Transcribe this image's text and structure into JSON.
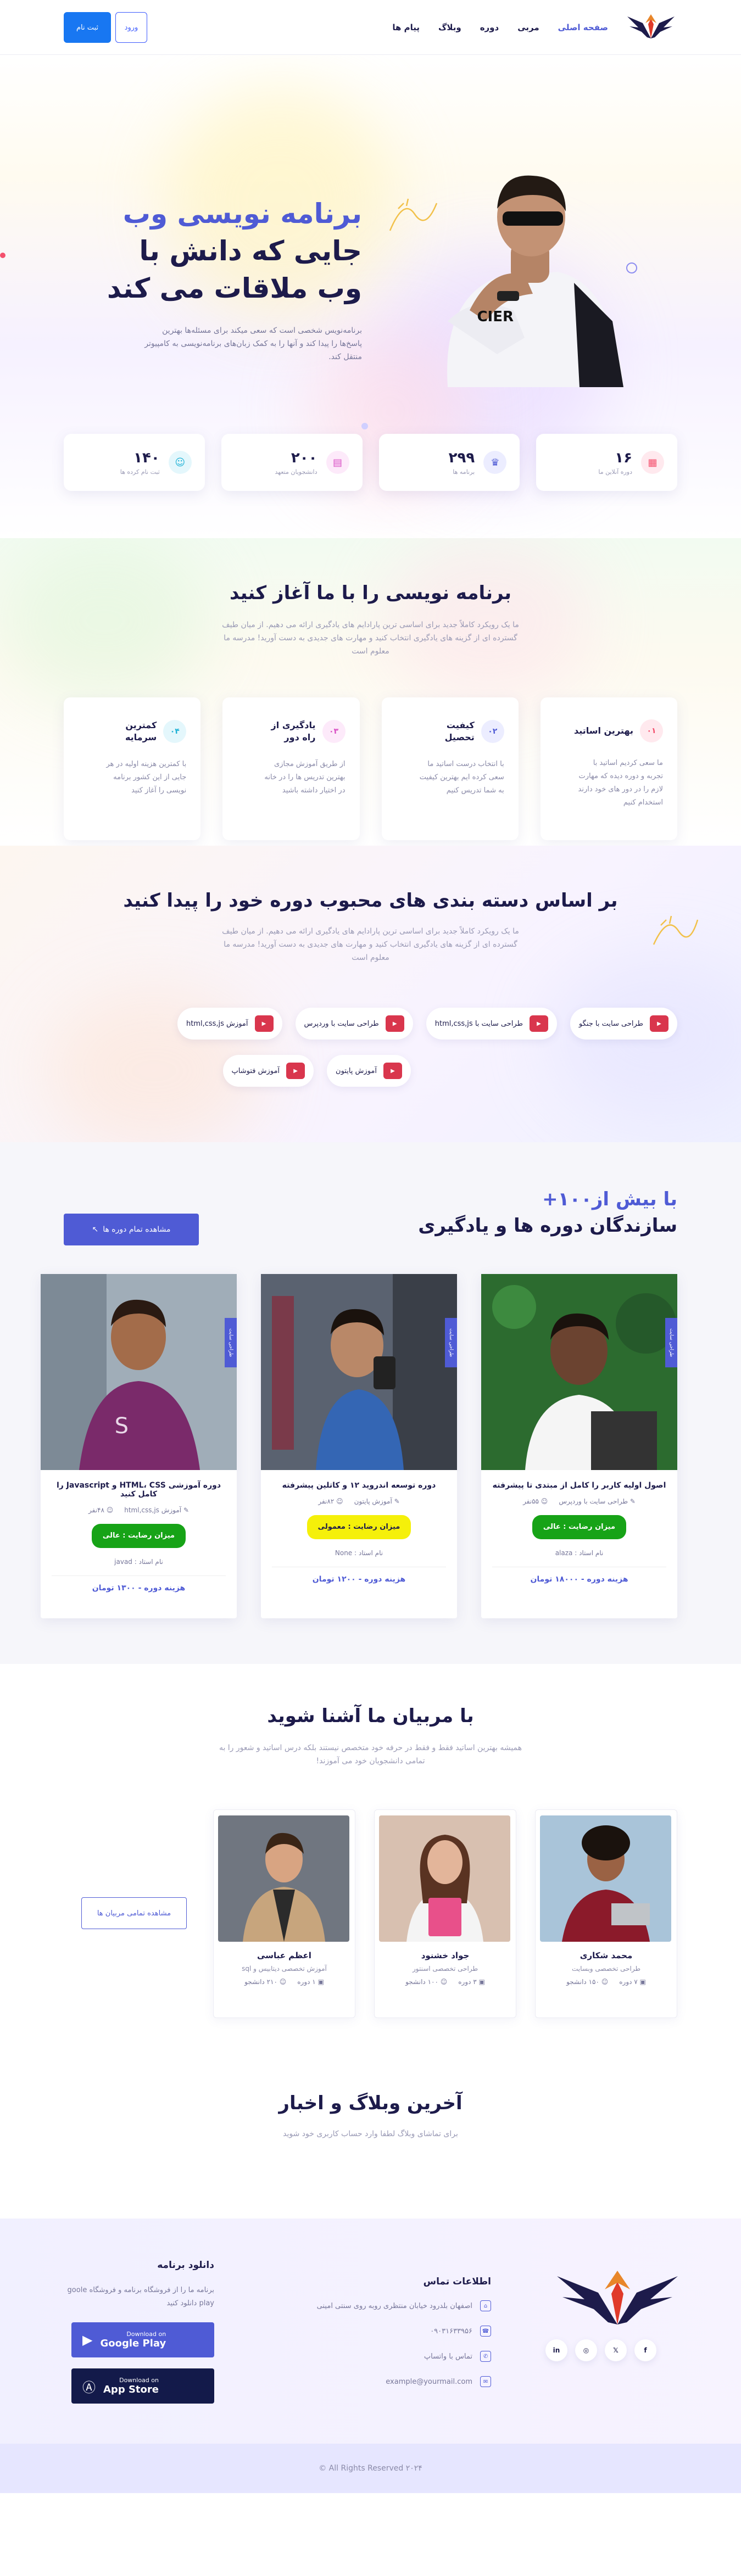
{
  "header": {
    "nav": [
      "صفحه اصلی",
      "مربی",
      "دوره",
      "وبلاگ",
      "پیام ها"
    ],
    "login": "ورود",
    "signup": "ثبت نام"
  },
  "hero": {
    "line1": "برنامه نویسی وب",
    "line2": "جایی که دانش با",
    "line3": "وب ملاقات می کند",
    "desc": "برنامه‌نویس شخصی است که سعی میکند برای مسئله‌ها بهترین پاسخ‌ها را پیدا کند و آنها را به کمک زبان‌های برنامه‌نویسی به کامپیوتر منتقل کند.",
    "stats": [
      {
        "num": "۱۶",
        "label": "دوره آنلاین ما",
        "icon": "calendar-icon",
        "color": "#f4506d",
        "bg": "#ffe9ee"
      },
      {
        "num": "۲۹۹",
        "label": "برنامه ها",
        "icon": "trophy-icon",
        "color": "#4f5bd5",
        "bg": "#ecedff"
      },
      {
        "num": "۲۰۰",
        "label": "دانشجویان متعهد",
        "icon": "id-card-icon",
        "color": "#d94fc4",
        "bg": "#fdeafa"
      },
      {
        "num": "۱۴۰",
        "label": "ثبت نام کرده ها",
        "icon": "user-icon",
        "color": "#21b2d6",
        "bg": "#e4f7fc"
      }
    ]
  },
  "why": {
    "title": "برنامه نویسی را با ما آغاز کنید",
    "sub": "ما یک رویکرد کاملاً جدید برای اساسی ترین پارادایم های یادگیری ارائه می دهیم. از میان طیف گسترده ای از گزینه های یادگیری انتخاب کنید و مهارت های جدیدی به دست آورید! مدرسه ما معلوم است",
    "items": [
      {
        "no": "۰۱",
        "title": "بهترین اساتید",
        "desc": "ما سعی کردیم اساتید با تجربه و دوره دیده که مهارت لازم را در دور های خود دارند استخدام کنیم",
        "color": "#f4506d",
        "bg": "#ffe9ee"
      },
      {
        "no": "۰۲",
        "title": "کیفیت تحصیل",
        "desc": "با انتخاب درست اساتید ما سعی کرده ایم بهترین کیفیت به شما تدریس کنیم",
        "color": "#4f5bd5",
        "bg": "#ecedff"
      },
      {
        "no": "۰۳",
        "title": "یادگیری از راه دور",
        "desc": "از طریق آموزش مجازی بهترین تدریس ها را در خانه در اختیار داشته باشید",
        "color": "#d94fc4",
        "bg": "#fdeafa"
      },
      {
        "no": "۰۴",
        "title": "کمترین سرمایه",
        "desc": "با کمترین هزینه اولیه در هر جایی از این کشور برنامه نویسی را آغاز کنید",
        "color": "#21b2d6",
        "bg": "#e4f7fc"
      }
    ]
  },
  "cats": {
    "title": "بر اساس دسته بندی های محبوب دوره خود را پیدا کنید",
    "sub": "ما یک رویکرد کاملاً جدید برای اساسی ترین پارادایم های یادگیری ارائه می دهیم. از میان طیف گسترده ای از گزینه های یادگیری انتخاب کنید و مهارت های جدیدی به دست آورید! مدرسه ما معلوم است",
    "items": [
      "طراحی سایت با جنگو",
      "طراحی سایت با html,css,js",
      "طراحی سایت با وردپرس",
      "آموزش html,css,js",
      "آموزش پایتون",
      "آموزش فتوشاپ"
    ]
  },
  "courses": {
    "title_hl": "با بیش از۱۰۰+",
    "title": "سازندگان دوره ها و یادگیری",
    "view_all": "مشاهده تمام دوره ها",
    "tag": "طراحی سایت",
    "items": [
      {
        "title": "اصول اولیه کاربر را کامل از مبتدی تا پیشرفته",
        "cat": "طراحی سایت با وردپرس",
        "views": "۵۵نفر",
        "level": "میزان رضایت : عالی",
        "level_bg": "#17a317",
        "level_fg": "#fff",
        "teacher": "نام استاد : alaza",
        "price": "هزینه دوره - ۱۸۰۰۰ تومان",
        "shirt": "#f5f5f5",
        "bg": "#2c6b2f"
      },
      {
        "title": "دوره توسعه اندروید ۱۲ و کاتلین پیشرفته",
        "cat": "آموزش پایتون",
        "views": "۸۲نفر",
        "level": "میزان رضایت : معمولی",
        "level_bg": "#f5f00a",
        "level_fg": "#1d1b4b",
        "teacher": "نام استاد : None",
        "price": "هزینه دوره - ۱۲۰۰ تومان",
        "shirt": "#3466b4",
        "bg": "#5a6270"
      },
      {
        "title": "دوره آموزشی HTML، CSS و Javascript را کامل کنید",
        "cat": "آموزش html,css,js",
        "views": "۴۸نفر",
        "level": "میزان رضایت : عالی",
        "level_bg": "#17a317",
        "level_fg": "#fff",
        "teacher": "نام استاد : javad",
        "price": "هزینه دوره - ۱۳۰۰ تومان",
        "shirt": "#7a2a6a",
        "bg": "#a0adb8"
      }
    ]
  },
  "mentors": {
    "title": "با مربیان ما آشنا شوید",
    "sub": "همیشه بهترین اساتید فقط و فقط در حرفه خود متخصص نیستند بلکه درس اساتید و شعور را به تمامی دانشجویان خود می آموزند!",
    "view_all": "مشاهده تمامی مربیان ها",
    "items": [
      {
        "name": "محمد شکاری",
        "role": "طراحی تخصصی وبسایت",
        "courses": "۷ دوره",
        "students": "۱۵۰ دانشجو",
        "shirt": "#8b1a2a",
        "bg": "#a9c4d9"
      },
      {
        "name": "جواد خشنود",
        "role": "طراحی تخصصی اسنتور",
        "courses": "۳ دوره",
        "students": "۱۰۰ دانشجو",
        "shirt": "#f4f4f4",
        "bg": "#d8c0b0"
      },
      {
        "name": "اعظم عباسی",
        "role": "آموزش تخصصی دیتابیس و sql",
        "courses": "۱ دوره",
        "students": "۲۱۰ دانشجو",
        "shirt": "#c7a57d",
        "bg": "#707680"
      }
    ]
  },
  "blog": {
    "title": "آخرین وبلاگ و اخبار",
    "sub": "برای تماشای وبلاگ لطفا وارد حساب کاربری خود شوید"
  },
  "footer": {
    "contact_title": "اطلاعات تماس",
    "address": "اصفهان بلدرود خیابان منتظری روبه روی سنتی امینی",
    "phone": "۰۹۰۳۱۶۳۳۹۵۶",
    "whatsapp": "تماس با واتساپ",
    "email": "example@yourmail.com",
    "dl_title": "دانلود برنامه",
    "dl_desc": "برنامه ما را از فروشگاه برنامه و فروشگاه goole play دانلود کنید",
    "gp_small": "Download on",
    "gp_big": "Google Play",
    "as_small": "Download on",
    "as_big": "App Store",
    "socials": [
      "in",
      "◎",
      "𝕏",
      "f"
    ],
    "copyright": "All Rights Reserved ۲۰۲۴ ©"
  }
}
